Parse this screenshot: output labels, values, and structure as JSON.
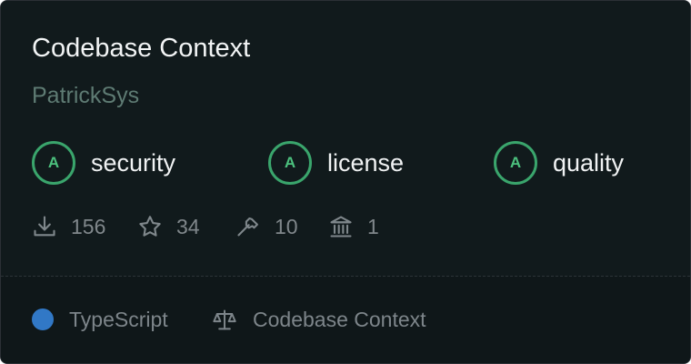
{
  "package": {
    "title": "Codebase Context",
    "author": "PatrickSys"
  },
  "scores": [
    {
      "grade": "A",
      "label": "security"
    },
    {
      "grade": "A",
      "label": "license"
    },
    {
      "grade": "A",
      "label": "quality"
    }
  ],
  "stats": [
    {
      "icon": "download-icon",
      "value": "156"
    },
    {
      "icon": "star-icon",
      "value": "34"
    },
    {
      "icon": "hammer-icon",
      "value": "10"
    },
    {
      "icon": "bank-icon",
      "value": "1"
    }
  ],
  "footer": {
    "language": "TypeScript",
    "language_color": "#3178c6",
    "license_icon": "scale-icon",
    "license_name": "Codebase Context"
  },
  "colors": {
    "grade": "#3aa56c",
    "background": "#101a1c"
  }
}
